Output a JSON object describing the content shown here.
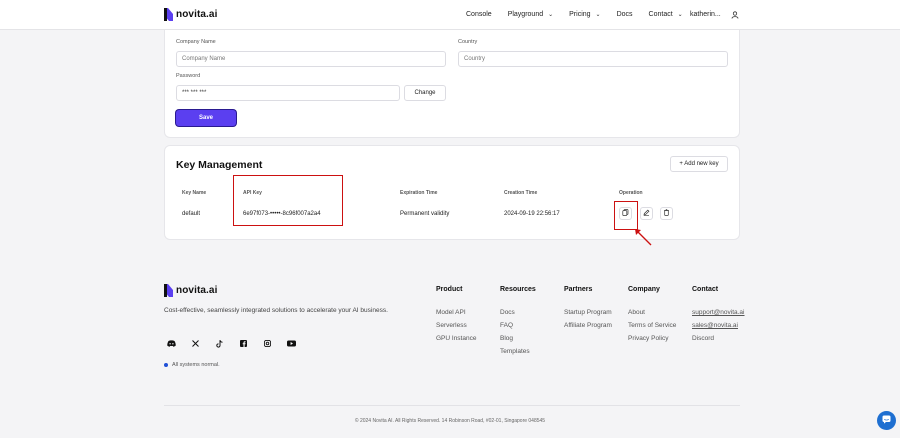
{
  "brand": {
    "name": "novita.ai",
    "accent": "#5b3ff0"
  },
  "nav": {
    "items": [
      {
        "label": "Console",
        "dropdown": false
      },
      {
        "label": "Playground",
        "dropdown": true
      },
      {
        "label": "Pricing",
        "dropdown": true
      },
      {
        "label": "Docs",
        "dropdown": false
      },
      {
        "label": "Contact",
        "dropdown": true
      }
    ],
    "user": "katherin...",
    "user_icon": "user-icon"
  },
  "profile": {
    "company_name_label": "Company Name",
    "company_name_placeholder": "Company Name",
    "country_label": "Country",
    "country_placeholder": "Country",
    "password_label": "Password",
    "password_value": "*** *** ***",
    "change_label": "Change",
    "save_label": "Save"
  },
  "keys": {
    "title": "Key Management",
    "add_label": "+ Add new key",
    "columns": [
      "Key Name",
      "API Key",
      "Expiration Time",
      "Creation Time",
      "Operation"
    ],
    "rows": [
      {
        "name": "default",
        "api_key": "6e97f073-•••••-8c96f007a2a4",
        "expiration": "Permanent validity",
        "created": "2024-09-19 22:56:17",
        "operations": [
          "copy-icon",
          "edit-icon",
          "delete-icon"
        ]
      }
    ]
  },
  "footer": {
    "brand": "novita.ai",
    "description": "Cost-effective, seamlessly integrated solutions to accelerate your AI business.",
    "social": [
      "discord-icon",
      "x-icon",
      "tiktok-icon",
      "facebook-icon",
      "instagram-icon",
      "youtube-icon"
    ],
    "status": "All systems normal.",
    "columns": [
      {
        "title": "Product",
        "links": [
          "Model API",
          "Serverless",
          "GPU Instance"
        ]
      },
      {
        "title": "Resources",
        "links": [
          "Docs",
          "FAQ",
          "Blog",
          "Templates"
        ]
      },
      {
        "title": "Partners",
        "links": [
          "Startup Program",
          "Affiliate Program"
        ]
      },
      {
        "title": "Company",
        "links": [
          "About",
          "Terms of Service",
          "Privacy Policy"
        ]
      },
      {
        "title": "Contact",
        "links": [
          "support@novita.ai",
          "sales@novita.ai",
          "Discord"
        ]
      }
    ],
    "copyright": "© 2024 Novita AI. All Rights Reserved. 14 Robinson Road, #02-01, Singapore 048545"
  },
  "colors": {
    "highlight": "#cc1111",
    "chat": "#1e6fd1",
    "status_dot": "#1f4fd6"
  }
}
